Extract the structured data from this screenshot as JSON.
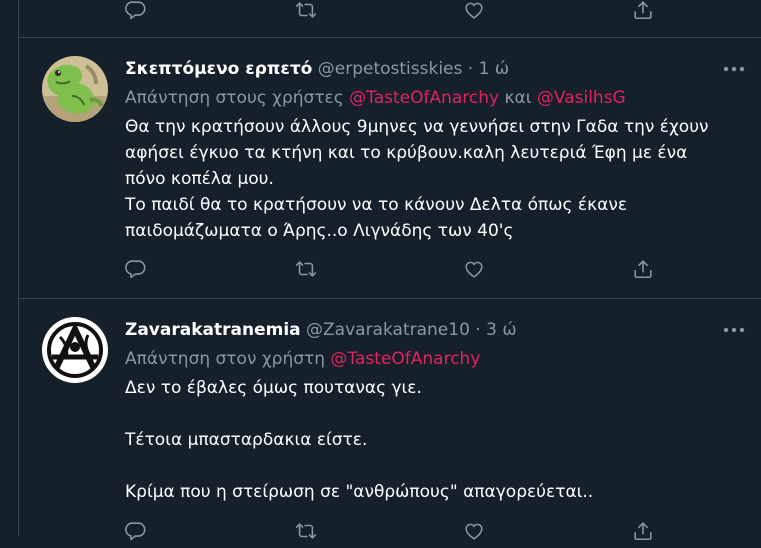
{
  "icons": {
    "reply": "reply-icon",
    "retweet": "retweet-icon",
    "like": "like-icon",
    "share": "share-icon",
    "more": "more-icon"
  },
  "colors": {
    "background": "#15202b",
    "border": "#38444d",
    "text": "#ffffff",
    "secondary": "#8899a6",
    "mention": "#e0245e"
  },
  "tweets": [
    {
      "name": "Σκεπτόμενο ερπετό",
      "handle": "@erpetostisskies",
      "separator": "·",
      "time": "1 ώ",
      "reply_prefix": "Απάντηση στους χρήστες",
      "mentions": [
        "@TasteOfAnarchy",
        "@VasilhsG"
      ],
      "mention_joiner": "και",
      "text_lines": [
        "Θα την κρατήσουν άλλους 9μηνες να γεννήσει στην Γαδα την έχουν",
        "αφήσει έγκυο τα κτήνη και το κρύβουν.καλη λευτεριά Έφη με ένα",
        "πόνο κοπέλα μου.",
        "Το παιδί θα το κρατήσουν να το κάνουν Δελτα όπως έκανε",
        "παιδομάζωματα ο Άρης..ο Λιγνάδης των 40'ς"
      ]
    },
    {
      "name": "Zavarakatranemia",
      "handle": "@Zavarakatrane10",
      "separator": "·",
      "time": "3 ώ",
      "reply_prefix": "Απάντηση στον χρήστη",
      "mentions": [
        "@TasteOfAnarchy"
      ],
      "text_lines": [
        "Δεν το έβαλες όμως πουτανας γιε.",
        "",
        "Τέτοια μπασταρδακια είστε.",
        "",
        "Κρίμα που η στείρωση σε \"ανθρώπους\" απαγορεύεται.."
      ]
    }
  ]
}
